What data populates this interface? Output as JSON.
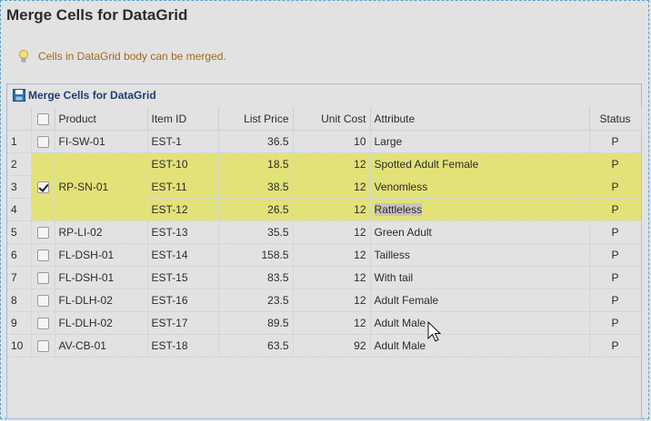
{
  "page": {
    "title": "Merge Cells for DataGrid"
  },
  "hint": {
    "text": "Cells in DataGrid body can be merged."
  },
  "panel": {
    "title": "Merge Cells for DataGrid"
  },
  "grid": {
    "columns": [
      "Product",
      "Item ID",
      "List Price",
      "Unit Cost",
      "Attribute",
      "Status"
    ],
    "rows": [
      {
        "n": "1",
        "product": "FI-SW-01",
        "item": "EST-1",
        "price": "36.5",
        "cost": "10",
        "attr": "Large",
        "status": "P"
      },
      {
        "n": "2",
        "product": "RP-SN-01",
        "item": "EST-10",
        "price": "18.5",
        "cost": "12",
        "attr": "Spotted Adult Female",
        "status": "P"
      },
      {
        "n": "3",
        "product": "",
        "item": "EST-11",
        "price": "38.5",
        "cost": "12",
        "attr": "Venomless",
        "status": "P"
      },
      {
        "n": "4",
        "product": "",
        "item": "EST-12",
        "price": "26.5",
        "cost": "12",
        "attr": "Rattleless",
        "status": "P"
      },
      {
        "n": "5",
        "product": "RP-LI-02",
        "item": "EST-13",
        "price": "35.5",
        "cost": "12",
        "attr": "Green Adult",
        "status": "P"
      },
      {
        "n": "6",
        "product": "FL-DSH-01",
        "item": "EST-14",
        "price": "158.5",
        "cost": "12",
        "attr": "Tailless",
        "status": "P"
      },
      {
        "n": "7",
        "product": "FL-DSH-01",
        "item": "EST-15",
        "price": "83.5",
        "cost": "12",
        "attr": "With tail",
        "status": "P"
      },
      {
        "n": "8",
        "product": "FL-DLH-02",
        "item": "EST-16",
        "price": "23.5",
        "cost": "12",
        "attr": "Adult Female",
        "status": "P"
      },
      {
        "n": "9",
        "product": "FL-DLH-02",
        "item": "EST-17",
        "price": "89.5",
        "cost": "12",
        "attr": "Adult Male",
        "status": "P"
      },
      {
        "n": "10",
        "product": "AV-CB-01",
        "item": "EST-18",
        "price": "63.5",
        "cost": "92",
        "attr": "Adult Male",
        "status": "P"
      }
    ]
  },
  "colors": {
    "selected_row": "#e2e278",
    "panel_title": "#1b3f73",
    "hint_text": "#a06a1a"
  },
  "icons": {
    "hint": "lightbulb-icon",
    "panel": "floppy-disk-icon",
    "cursor": "mouse-pointer-icon"
  }
}
